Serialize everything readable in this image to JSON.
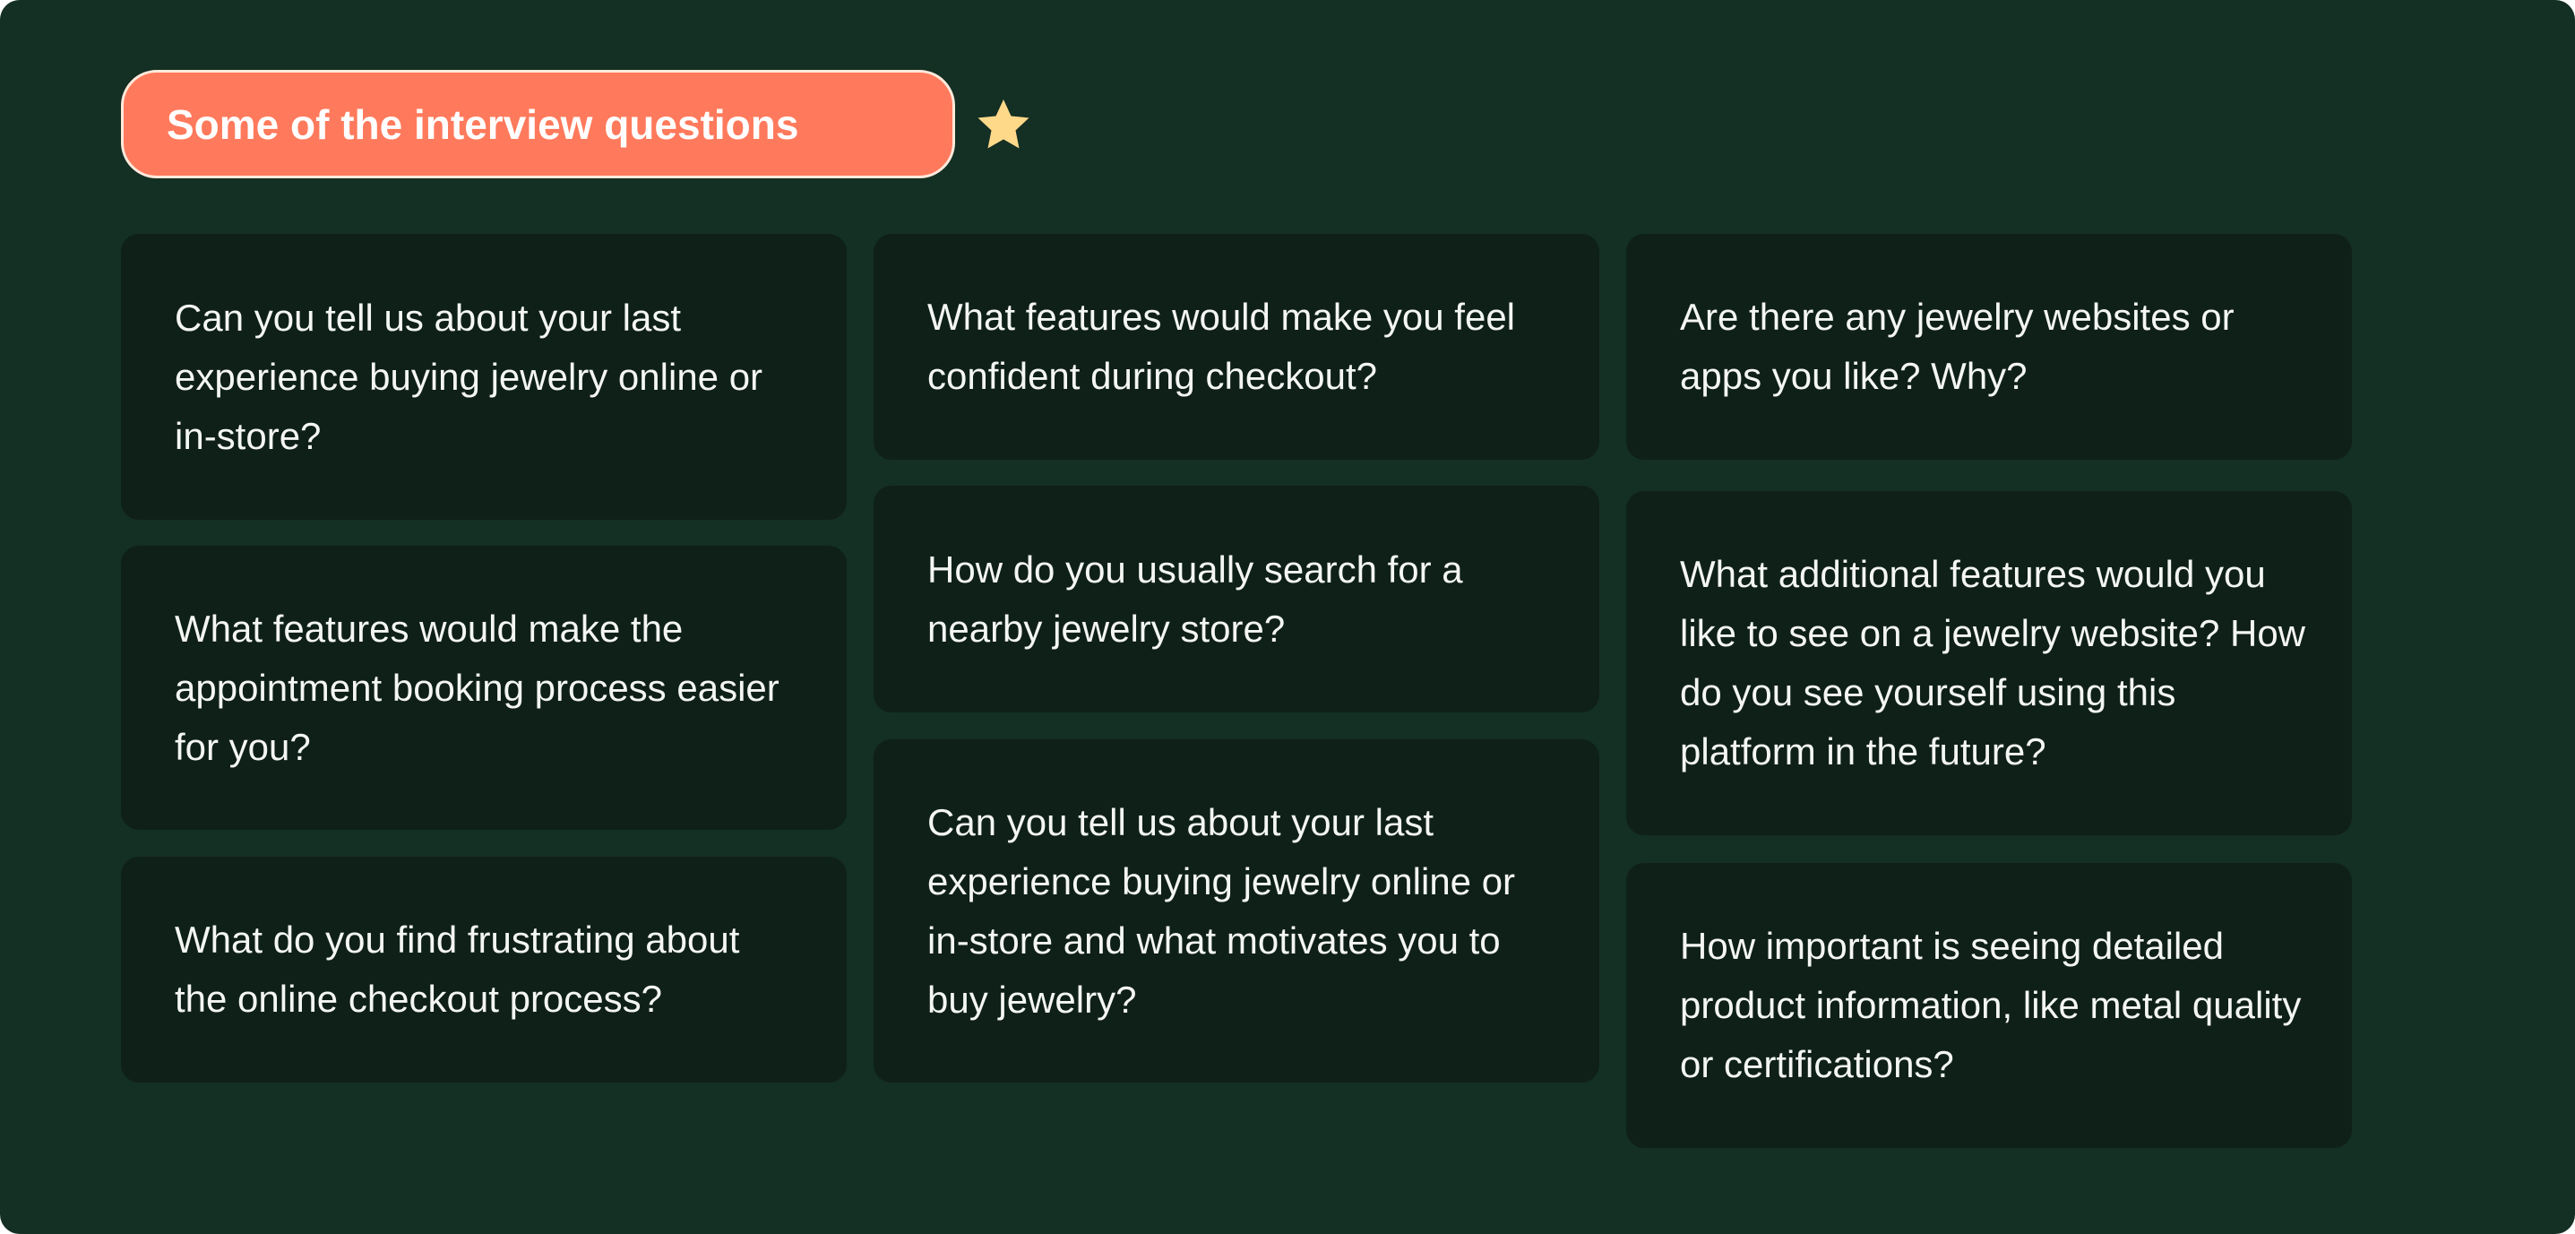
{
  "header": {
    "title": "Some of the interview questions",
    "icon": "star-icon",
    "pill_color": "#ff7a5c",
    "star_color": "#ffd98a"
  },
  "questions": [
    "Can you tell us about your last experience buying jewelry online or in-store?",
    "What features would make the appointment booking process easier for you?",
    "What do you find frustrating about the online checkout process?",
    "What features would make you feel confident during checkout?",
    "How do you usually search for a nearby jewelry store?",
    "Can you tell us about your last experience buying jewelry online or in-store and what motivates you to buy jewelry?",
    "Are there any jewelry websites or apps you like? Why?",
    "What additional features would you like to see on a jewelry website? How do you see yourself using this platform in the future?",
    "How important is seeing detailed product information, like metal quality or certifications?"
  ],
  "colors": {
    "background": "#142f23",
    "card": "#0f2019",
    "text": "#f4f6f3"
  }
}
